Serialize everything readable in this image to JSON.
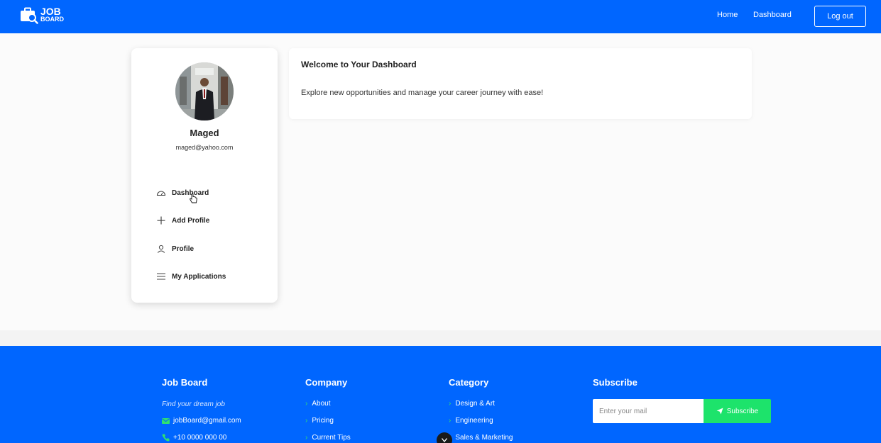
{
  "header": {
    "logo_line1": "JOB",
    "logo_line2": "BOARD",
    "nav": {
      "home": "Home",
      "dashboard": "Dashboard"
    },
    "logout": "Log out",
    "brand_color": "#0066ff"
  },
  "profile": {
    "name": "Maged",
    "email": "maged@yahoo.com",
    "menu": [
      {
        "label": "Dashboard",
        "icon": "dashboard-gauge-icon"
      },
      {
        "label": "Add Profile",
        "icon": "plus-icon"
      },
      {
        "label": "Profile",
        "icon": "user-icon"
      },
      {
        "label": "My Applications",
        "icon": "list-icon"
      }
    ]
  },
  "welcome": {
    "title": "Welcome to Your Dashboard",
    "subtitle": "Explore new opportunities and manage your career journey with ease!"
  },
  "footer": {
    "jobboard": {
      "heading": "Job Board",
      "tagline": "Find your dream job",
      "email": "jobBoard@gmail.com",
      "phone": "+10 0000 000 00"
    },
    "company": {
      "heading": "Company",
      "links": [
        "About",
        "Pricing",
        "Current Tips"
      ]
    },
    "category": {
      "heading": "Category",
      "links": [
        "Design & Art",
        "Engineering",
        "Sales & Marketing"
      ]
    },
    "subscribe": {
      "heading": "Subscribe",
      "placeholder": "Enter your mail",
      "button": "Subscribe",
      "button_color": "#1de36b"
    }
  }
}
